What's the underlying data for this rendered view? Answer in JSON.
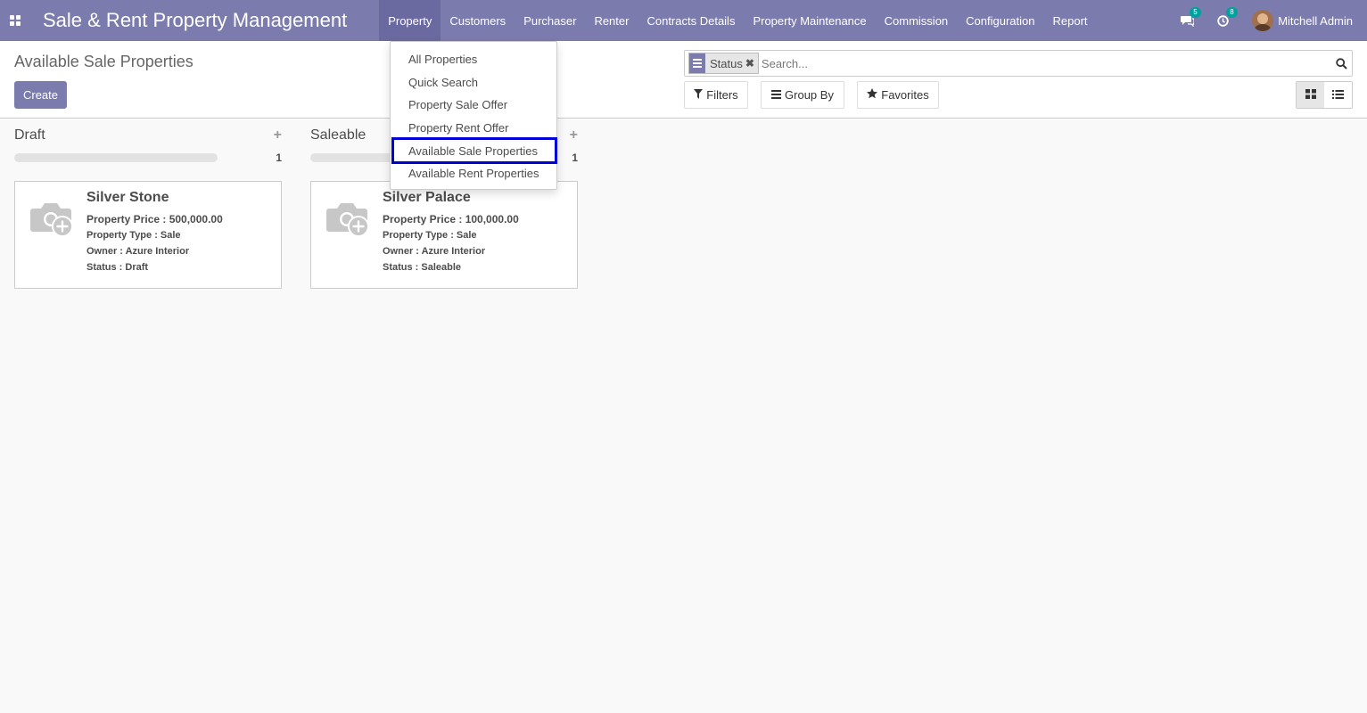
{
  "navbar": {
    "app_title": "Sale & Rent Property Management",
    "menu": [
      "Property",
      "Customers",
      "Purchaser",
      "Renter",
      "Contracts Details",
      "Property Maintenance",
      "Commission",
      "Configuration",
      "Report"
    ],
    "active_menu": "Property",
    "messages_count": "5",
    "activities_count": "8",
    "user_name": "Mitchell Admin"
  },
  "property_menu": {
    "items": [
      "All Properties",
      "Quick Search",
      "Property Sale Offer",
      "Property Rent Offer",
      "Available Sale Properties",
      "Available Rent Properties"
    ],
    "highlighted": "Available Sale Properties"
  },
  "control_panel": {
    "breadcrumb": "Available Sale Properties",
    "create_label": "Create",
    "search": {
      "facet_label": "Status",
      "placeholder": "Search..."
    },
    "filters_label": "Filters",
    "group_by_label": "Group By",
    "favorites_label": "Favorites",
    "active_view": "kanban"
  },
  "kanban": {
    "columns": [
      {
        "title": "Draft",
        "count": "1",
        "card": {
          "name": "Silver Stone",
          "price": "Property Price : 500,000.00",
          "type": "Property Type : Sale",
          "owner": "Owner : Azure Interior",
          "status": "Status : Draft"
        }
      },
      {
        "title": "Saleable",
        "count": "1",
        "card": {
          "name": "Silver Palace",
          "price": "Property Price : 100,000.00",
          "type": "Property Type : Sale",
          "owner": "Owner : Azure Interior",
          "status": "Status : Saleable"
        }
      }
    ]
  },
  "colors": {
    "brand": "#7c7bad",
    "badge": "#00a09d",
    "highlight_outline": "#0000d8"
  }
}
